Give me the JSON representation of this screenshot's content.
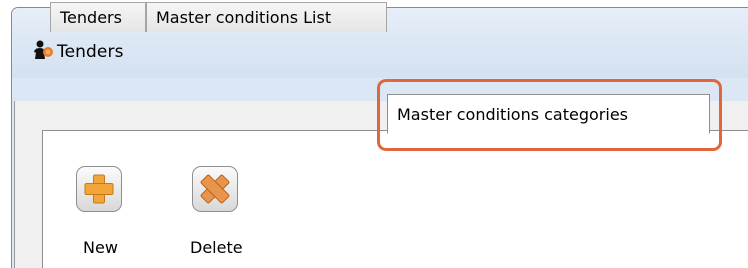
{
  "window": {
    "title": "Tenders"
  },
  "tabs": [
    {
      "label": "Tenders",
      "active": false
    },
    {
      "label": "Master conditions List",
      "active": false
    },
    {
      "label": "Master conditions categories",
      "active": true
    }
  ],
  "toolbar": {
    "new_label": "New",
    "delete_label": "Delete"
  },
  "colors": {
    "highlight": "#e0673d",
    "add_icon": "#f2a63a",
    "delete_icon": "#e8944a"
  },
  "icons": {
    "app": "tenders-app-icon",
    "new": "plus-icon",
    "delete": "x-icon"
  }
}
